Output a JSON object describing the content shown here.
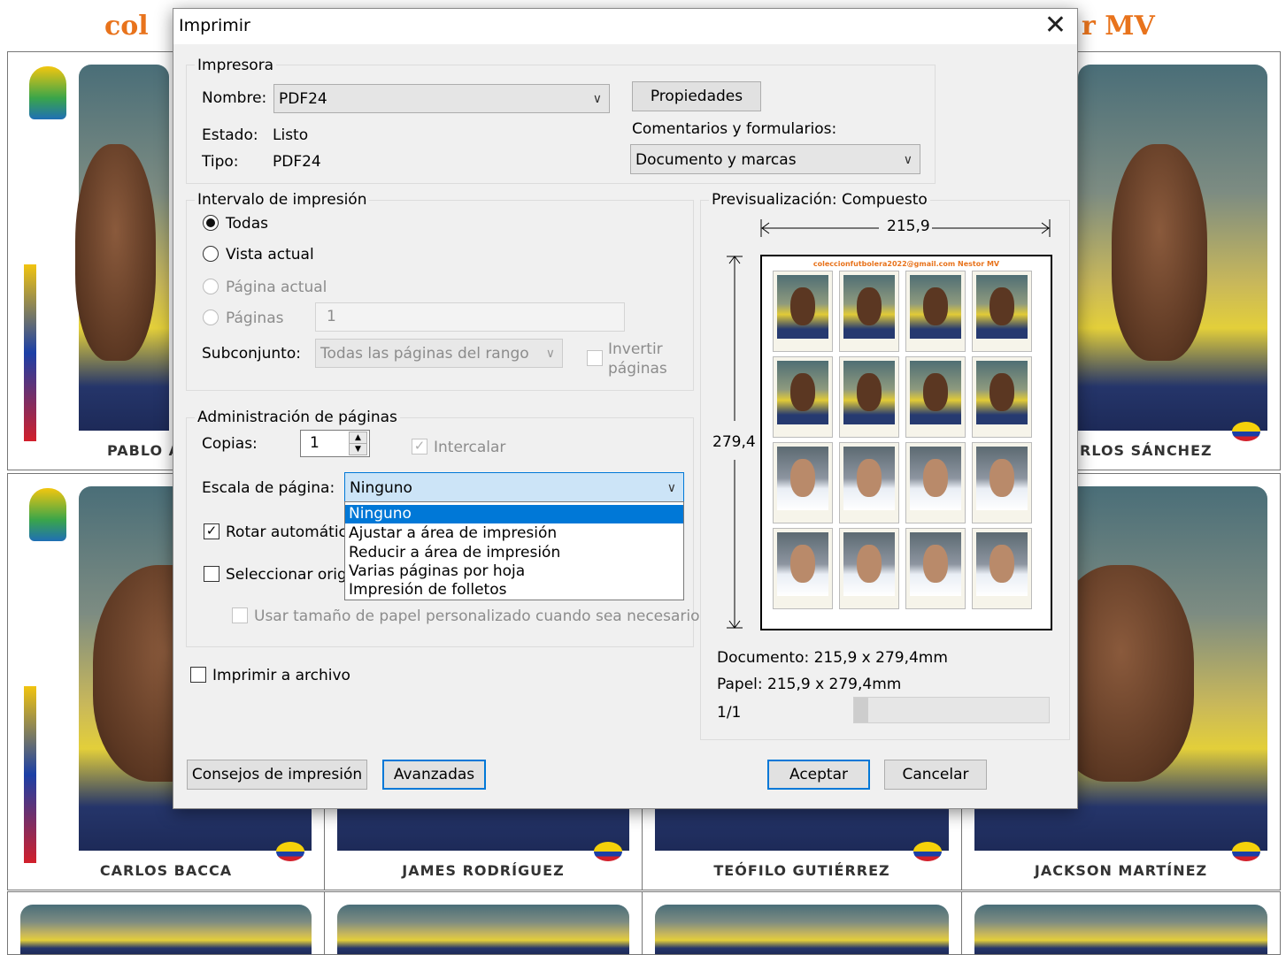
{
  "background": {
    "sheet_title_left": "col",
    "sheet_title_right": "r MV",
    "sticker_names": [
      "PABLO A",
      "RLOS SÁNCHEZ",
      "CARLOS BACCA",
      "JAMES RODRÍGUEZ",
      "TEÓFILO GUTIÉRREZ",
      "JACKSON MARTÍNEZ"
    ]
  },
  "dialog": {
    "title": "Imprimir",
    "printer": {
      "legend": "Impresora",
      "name_label": "Nombre:",
      "name_value": "PDF24",
      "properties_button": "Propiedades",
      "status_label": "Estado:",
      "status_value": "Listo",
      "type_label": "Tipo:",
      "type_value": "PDF24",
      "comments_label": "Comentarios y formularios:",
      "comments_value": "Documento y marcas"
    },
    "range": {
      "legend": "Intervalo de impresión",
      "all": "Todas",
      "current_view": "Vista actual",
      "current_page": "Página actual",
      "pages": "Páginas",
      "pages_value": "1",
      "subset_label": "Subconjunto:",
      "subset_value": "Todas las páginas del rango",
      "reverse_line1": "Invertir",
      "reverse_line2": "páginas"
    },
    "handling": {
      "legend": "Administración de páginas",
      "copies_label": "Copias:",
      "copies_value": "1",
      "collate": "Intercalar",
      "scale_label": "Escala de página:",
      "scale_value": "Ninguno",
      "autorotate": "Rotar automática",
      "choose_source": "Seleccionar orige",
      "custom_paper": "Usar tamaño de papel personalizado cuando sea necesario",
      "scale_options": [
        "Ninguno",
        "Ajustar a área de impresión",
        "Reducir a área de impresión",
        "Varias páginas por hoja",
        "Impresión de folletos"
      ]
    },
    "print_to_file": "Imprimir a archivo",
    "preview": {
      "legend": "Previsualización: Compuesto",
      "width": "215,9",
      "height": "279,4",
      "sheet_title": "coleccionfutbolera2022@gmail.com  Nestor MV",
      "document": "Documento: 215,9 x 279,4mm",
      "paper": "Papel: 215,9 x 279,4mm",
      "page_counter": "1/1",
      "page_slider_fraction": 0.0
    },
    "buttons": {
      "tips": "Consejos de impresión",
      "advanced": "Avanzadas",
      "ok": "Aceptar",
      "cancel": "Cancelar"
    }
  },
  "colors": {
    "accent": "#0078d7",
    "dialog_bg": "#f0f0f0",
    "sheet_title": "#e8731c"
  }
}
